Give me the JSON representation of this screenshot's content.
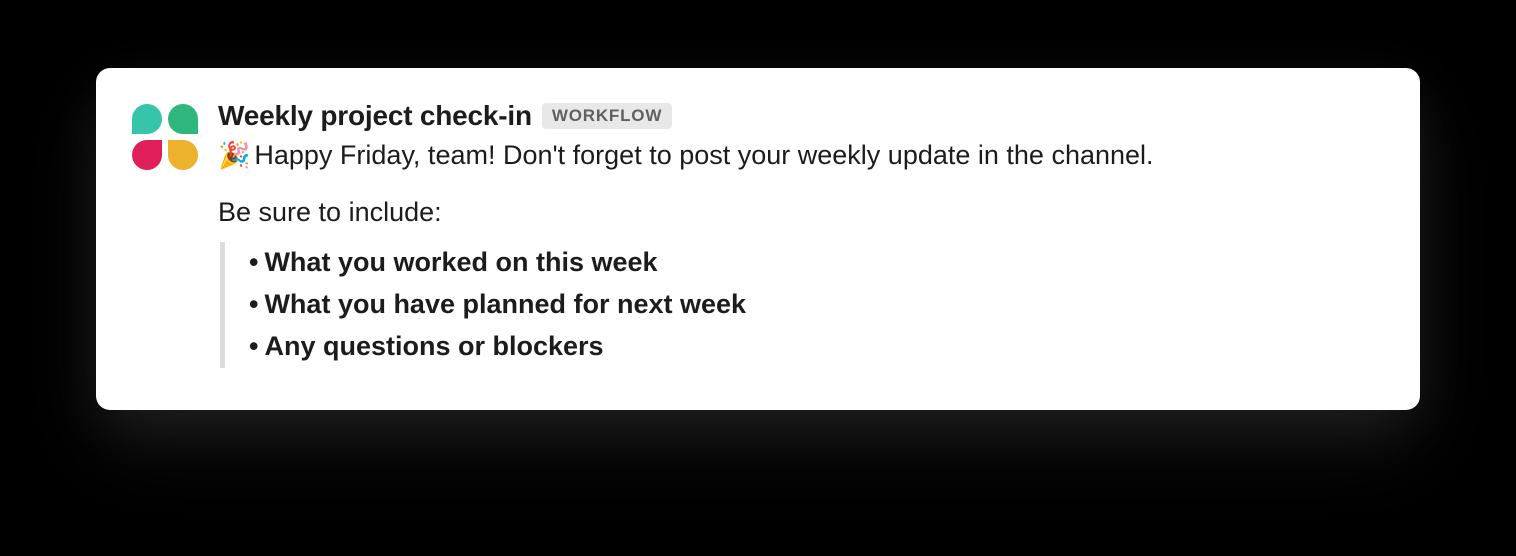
{
  "message": {
    "title": "Weekly project check-in",
    "badge": "WORKFLOW",
    "emoji": "🎉",
    "body": "Happy Friday, team! Don't forget to post your weekly update in the channel.",
    "sub": "Be sure to include:",
    "bullets": [
      "What you worked on this week",
      "What you have planned for next week",
      "Any questions or blockers"
    ]
  }
}
